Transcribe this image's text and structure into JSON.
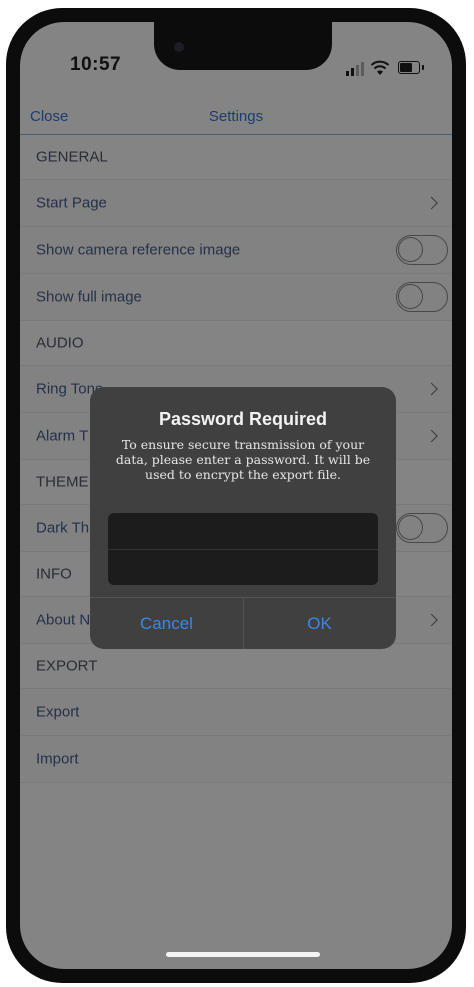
{
  "status_bar": {
    "time": "10:57",
    "icons": [
      "signal-icon",
      "wifi-icon",
      "battery-icon"
    ]
  },
  "navbar": {
    "close_label": "Close",
    "title": "Settings"
  },
  "settings": {
    "general_header": "GENERAL",
    "start_page": "Start Page",
    "show_camera_ref": "Show camera reference image",
    "show_full_image": "Show full image",
    "audio_header": "AUDIO",
    "ring_tone": "Ring Tone",
    "alarm_tone": "Alarm T",
    "theme_header": "THEME",
    "dark_theme": "Dark Th",
    "info_header": "INFO",
    "about": "About N",
    "export_header": "EXPORT",
    "export": "Export",
    "import": "Import"
  },
  "alert": {
    "title": "Password Required",
    "message": "To ensure secure transmission of your data, please enter a password. It will be used to encrypt the export file.",
    "password_value": "",
    "cancel_label": "Cancel",
    "ok_label": "OK"
  },
  "colors": {
    "accent": "#3b87e8",
    "list_text": "#26324b",
    "background": "#878787",
    "alert_background": "#404040"
  }
}
